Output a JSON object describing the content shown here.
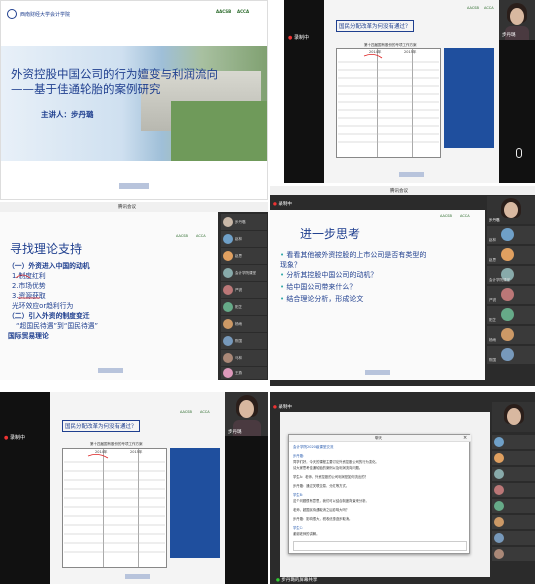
{
  "panel1": {
    "school_name": "西南财经大学会计学院",
    "badges": [
      "AACSB",
      "ACCA"
    ],
    "title_line1": "外资控股中国公司的行为嬗变与利润流向",
    "title_line2": "——基于佳通轮胎的案例研究",
    "presenter": "主讲人：步丹璐",
    "footer_logo": "西南财经大学会计学院"
  },
  "panel2": {
    "heading": "国民分配改革为何没有通过？",
    "table_title": "第十四届国有股份的专项工作方案",
    "col1": "2014年",
    "col2": "2015年",
    "side_text": "",
    "recording": "录制中",
    "speaker": "步丹璐",
    "badges": [
      "AACSB",
      "ACCA"
    ]
  },
  "panel3": {
    "window_title": "腾讯会议",
    "title": "寻找理论支持",
    "items": [
      "（一）外资进入中国的动机",
      "1.制度红利",
      "2.市场优势",
      "3.资源获取",
      "光环效应or趋利行为",
      "（二）引入外资的制度变迁",
      "“超国民待遇”到“国民待遇”",
      "国际贸易理论"
    ],
    "participants": [
      "步丹璐",
      "赵林",
      "赵思",
      "会计学院课堂",
      "严锐",
      "阳芷",
      "杨雨",
      "陈国",
      "马林",
      "王燕"
    ],
    "badges": [
      "AACSB",
      "ACCA"
    ]
  },
  "panel4": {
    "window_title": "腾讯会议",
    "recording": "录制中",
    "title": "进一步思考",
    "items": [
      "看看其他被外资控股的上市公司是否有类型的现象？",
      "分析其控股中国公司的动机？",
      "给中国公司带来什么？",
      "结合理论分析，形成论文"
    ],
    "participants": [
      "步丹璐",
      "赵林",
      "赵思",
      "会计学院课堂",
      "严锐",
      "阳芷",
      "杨雨",
      "陈国"
    ],
    "badges": [
      "AACSB",
      "ACCA"
    ]
  },
  "panel5": {
    "heading": "国民分配改革为何没有通过？",
    "table_title": "第十四届国有股份的专项工作方案",
    "col1": "2014年",
    "col2": "2015年",
    "recording": "录制中",
    "speaker": "步丹璐",
    "badges": [
      "AACSB",
      "ACCA"
    ]
  },
  "panel6": {
    "window_title": "聊天",
    "recording": "录制中",
    "chat_header": "会计学院2020级课堂交流",
    "chat_lines": [
      "步丹璐：",
      "同学们好，今天的课程主要讨论外资控股公司的行为变化。",
      "请大家思考佳通轮胎的案例以及利润流向问题。",
      "学生A：老师，外资控股的公司利润是如何流出的？",
      "步丹璐：通过关联交易、分红等方式。",
      "学生B：",
      "这个问题很有意思，我们可以结合制度背景来分析。",
      "老师，超国民待遇取消之后影响大吗？",
      "步丹璐：影响很大，税收优惠逐步取消。",
      "学生C：",
      "谢谢老师的讲解。"
    ],
    "input_placeholder": "",
    "bottom_label": "步丹璐的屏幕共享",
    "badges": [
      "AACSB",
      "ACCA"
    ]
  }
}
